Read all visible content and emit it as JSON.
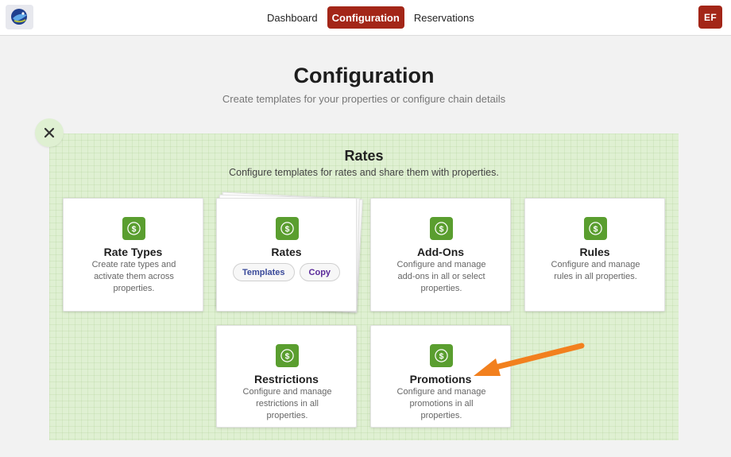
{
  "nav": {
    "items": [
      {
        "label": "Dashboard"
      },
      {
        "label": "Configuration",
        "active": true
      },
      {
        "label": "Reservations"
      }
    ],
    "user_initials": "EF"
  },
  "page": {
    "title": "Configuration",
    "subtitle": "Create templates for your properties or configure chain details"
  },
  "panel": {
    "title": "Rates",
    "subtitle": "Configure templates for rates and share them with properties."
  },
  "cards": {
    "rate_types": {
      "title": "Rate Types",
      "desc": "Create rate types and activate them across properties.",
      "icon": "dollar-icon"
    },
    "rates": {
      "title": "Rates",
      "templates_label": "Templates",
      "copy_label": "Copy",
      "icon": "dollar-icon"
    },
    "addons": {
      "title": "Add-Ons",
      "desc": "Configure and manage add-ons in all or select properties.",
      "icon": "dollar-icon"
    },
    "rules": {
      "title": "Rules",
      "desc": "Configure and manage rules in all properties.",
      "icon": "dollar-icon"
    },
    "restrictions": {
      "title": "Restrictions",
      "desc": "Configure and manage restrictions in all properties.",
      "icon": "dollar-icon"
    },
    "promotions": {
      "title": "Promotions",
      "desc": "Configure and manage promotions in all properties.",
      "icon": "dollar-icon"
    }
  },
  "colors": {
    "brand": "#a32618",
    "panel_bg": "#dff0d2",
    "icon_green": "#5a9e2f",
    "annotation_arrow": "#f2801e"
  }
}
